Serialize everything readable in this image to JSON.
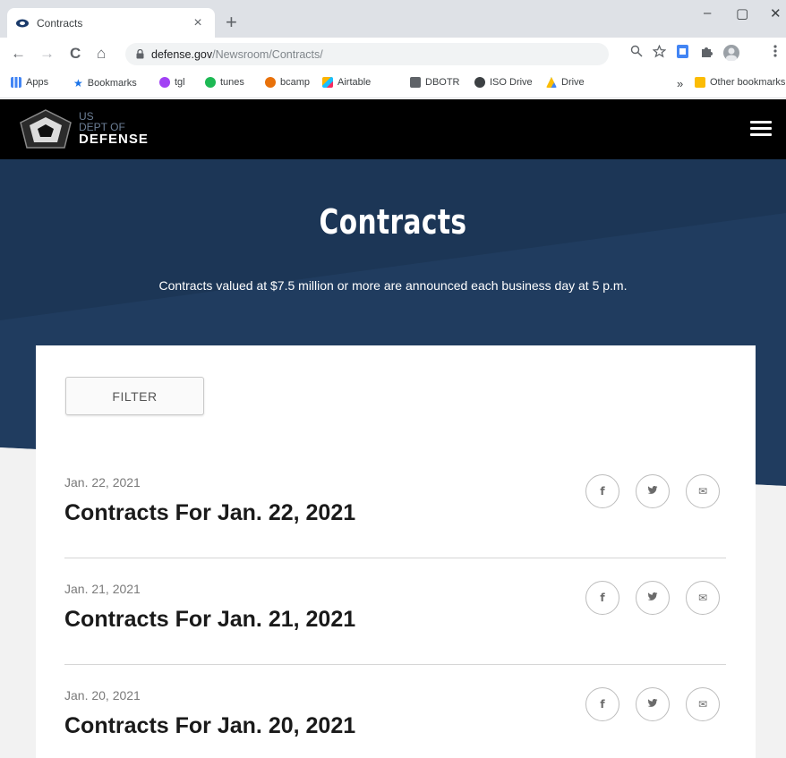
{
  "browser": {
    "tab_title": "Contracts",
    "tab_close": "×",
    "new_tab": "+",
    "window_controls": {
      "minimize": "–",
      "maximize": "▢",
      "close": "✕"
    },
    "nav": {
      "back": "←",
      "forward": "→",
      "reload": "C",
      "home": "⌂"
    },
    "url_host": "defense.gov",
    "url_path": "/Newsroom/Contracts/",
    "bookmarks": [
      {
        "label": "Apps",
        "icon": "apps-grid-icon",
        "color": "#4285f4"
      },
      {
        "label": "Bookmarks",
        "icon": "star-icon",
        "color": "#1a73e8"
      },
      {
        "label": "tgl",
        "icon": "purple-circle-icon",
        "color": "#a142f4"
      },
      {
        "label": "tunes",
        "icon": "spotify-icon",
        "color": "#1db954"
      },
      {
        "label": "bcamp",
        "icon": "orange-circle-icon",
        "color": "#e8710a"
      },
      {
        "label": "Airtable",
        "icon": "airtable-icon",
        "color": "#fcb400"
      },
      {
        "label": "DBOTR",
        "icon": "dbotr-icon",
        "color": "#5f6368"
      },
      {
        "label": "ISO Drive",
        "icon": "iso-drive-icon",
        "color": "#3c4043"
      },
      {
        "label": "Drive",
        "icon": "google-drive-icon",
        "color": "#0f9d58"
      }
    ],
    "bookmarks_more": "»",
    "other_bookmarks": "Other bookmarks"
  },
  "site": {
    "logo_us": "US",
    "logo_dept": "DEPT OF",
    "logo_defense": "DEFENSE"
  },
  "hero": {
    "title": "Contracts",
    "subtitle": "Contracts valued at $7.5 million or more are announced each business day at 5 p.m."
  },
  "filter_label": "FILTER",
  "items": [
    {
      "date": "Jan. 22, 2021",
      "title": "Contracts For Jan. 22, 2021"
    },
    {
      "date": "Jan. 21, 2021",
      "title": "Contracts For Jan. 21, 2021"
    },
    {
      "date": "Jan. 20, 2021",
      "title": "Contracts For Jan. 20, 2021"
    }
  ],
  "share_glyphs": {
    "facebook": "f",
    "twitter": "▼",
    "email": "✉"
  },
  "colors": {
    "hero_dark": "#1c3656",
    "hero_mid": "#223e61",
    "header_bg": "#000000",
    "page_gray": "#f2f2f2"
  }
}
